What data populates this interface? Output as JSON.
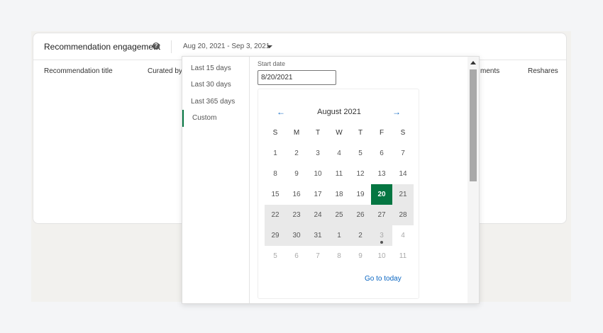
{
  "card": {
    "title": "Recommendation engagement",
    "help_glyph": "?",
    "date_range": "Aug 20, 2021 - Sep 3, 2021",
    "columns": {
      "recommendation_title": "Recommendation title",
      "curated_by": "Curated by",
      "comments": "ments",
      "reshares": "Reshares"
    }
  },
  "popover": {
    "presets": [
      {
        "label": "Last 15 days"
      },
      {
        "label": "Last 30 days"
      },
      {
        "label": "Last 365 days"
      },
      {
        "label": "Custom"
      }
    ],
    "start_label": "Start date",
    "start_value": "8/20/2021",
    "month_title": "August 2021",
    "prev_glyph": "←",
    "next_glyph": "→",
    "dow": [
      "S",
      "M",
      "T",
      "W",
      "T",
      "F",
      "S"
    ],
    "weeks": [
      [
        "1",
        "2",
        "3",
        "4",
        "5",
        "6",
        "7"
      ],
      [
        "8",
        "9",
        "10",
        "11",
        "12",
        "13",
        "14"
      ],
      [
        "15",
        "16",
        "17",
        "18",
        "19",
        "20",
        "21"
      ],
      [
        "22",
        "23",
        "24",
        "25",
        "26",
        "27",
        "28"
      ],
      [
        "29",
        "30",
        "31",
        "1",
        "2",
        "3",
        "4"
      ],
      [
        "5",
        "6",
        "7",
        "8",
        "9",
        "10",
        "11"
      ]
    ],
    "go_today": "Go to today"
  },
  "colors": {
    "accent": "#057642",
    "link": "#0a66c2",
    "range": "#e9e9e9"
  }
}
